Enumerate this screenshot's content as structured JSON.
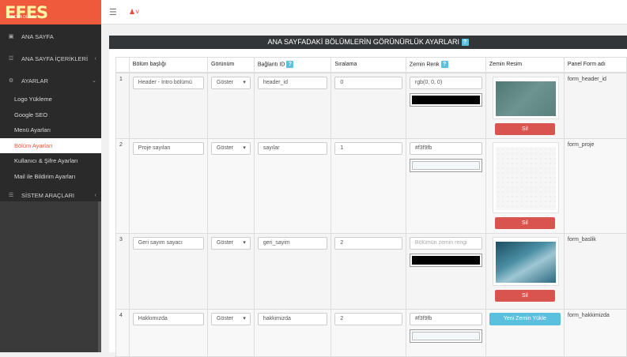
{
  "logo": {
    "main": "EFES",
    "sub": "TECHNOLOGY"
  },
  "sidebar": {
    "items": [
      {
        "label": "ANA SAYFA",
        "icon": "dashboard-icon"
      },
      {
        "label": "ANA SAYFA İÇERİKLERİ",
        "icon": "sitemap-icon"
      },
      {
        "label": "AYARLAR",
        "icon": "gear-icon"
      }
    ],
    "subitems": [
      "Logo Yükleme",
      "Google SEO",
      "Menü Ayarları",
      "Bölüm Ayarları",
      "Kullanıcı & Şifre Ayarları",
      "Mail ile Bildirim Ayarları"
    ],
    "tools": {
      "label": "SİSTEM ARAÇLARI",
      "icon": "list-icon"
    }
  },
  "panel": {
    "title": "ANA SAYFADAKİ BÖLÜMLERİN GÖRÜNÜRLÜK AYARLARI",
    "help": "?"
  },
  "table": {
    "headers": {
      "title": "Bölüm başlığı",
      "visibility": "Görünüm",
      "link": "Bağlantı ID",
      "order": "Sıralama",
      "bg_color": "Zemin Renk",
      "bg_image": "Zemin Resim",
      "panel": "Panel Form adı",
      "help": "?"
    },
    "rows": [
      {
        "num": "1",
        "title": "Header - İntro bölümü",
        "visibility": "Göster",
        "link": "header_id",
        "order": "0",
        "color_value": "rgb(0, 0, 0)",
        "color_placeholder": "",
        "swatch": "#000000",
        "image": "teal",
        "action": "Sil",
        "panel": "form_header_id"
      },
      {
        "num": "2",
        "title": "Proje sayıları",
        "visibility": "Göster",
        "link": "sayılar",
        "order": "1",
        "color_value": "#f3f9fb",
        "color_placeholder": "",
        "swatch": "#f3f9fb",
        "image": "light",
        "action": "Sil",
        "panel": "form_proje"
      },
      {
        "num": "3",
        "title": "Geri sayım sayacı",
        "visibility": "Göster",
        "link": "geri_sayim",
        "order": "2",
        "color_value": "",
        "color_placeholder": "Bölümün zemin rengi",
        "swatch": "#000000",
        "image": "poly",
        "action": "Sil",
        "panel": "form_baslik"
      },
      {
        "num": "4",
        "title": "Hakkımızda",
        "visibility": "Göster",
        "link": "hakkimizda",
        "order": "2",
        "color_value": "#f3f9fb",
        "color_placeholder": "",
        "swatch": "#f3f9fb",
        "image": "none",
        "action": "Yeni Zemin Yükle",
        "panel": "form_hakkimizda"
      }
    ]
  },
  "colors": {
    "accent": "#ef5a3c",
    "danger": "#d9534f",
    "info": "#5bc0de",
    "sidebar": "#2a2a2a"
  }
}
